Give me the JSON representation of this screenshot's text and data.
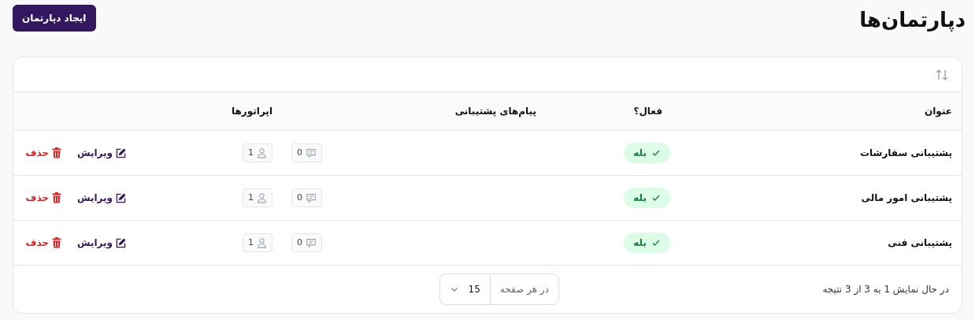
{
  "page": {
    "title": "دپارتمان‌ها",
    "create_button": "ایجاد دپارتمان"
  },
  "table": {
    "columns": [
      "عنوان",
      "فعال؟",
      "پیام‌های پشتیبانی",
      "اپراتورها"
    ],
    "rows": [
      {
        "title": "پشتیبانی سفارشات",
        "active": true,
        "active_label": "بله",
        "messages": "0",
        "operators": "1",
        "edit": "ویرایش",
        "delete": "حذف"
      },
      {
        "title": "پشتیبانی امور مالی",
        "active": true,
        "active_label": "بله",
        "messages": "0",
        "operators": "1",
        "edit": "ویرایش",
        "delete": "حذف"
      },
      {
        "title": "پشتیبانی فنی",
        "active": true,
        "active_label": "بله",
        "messages": "0",
        "operators": "1",
        "edit": "ویرایش",
        "delete": "حذف"
      }
    ]
  },
  "footer": {
    "summary": "در حال نمایش 1 به 3 از 3 نتیجه",
    "per_page_label": "در هر صفحه",
    "per_page_value": "15"
  }
}
